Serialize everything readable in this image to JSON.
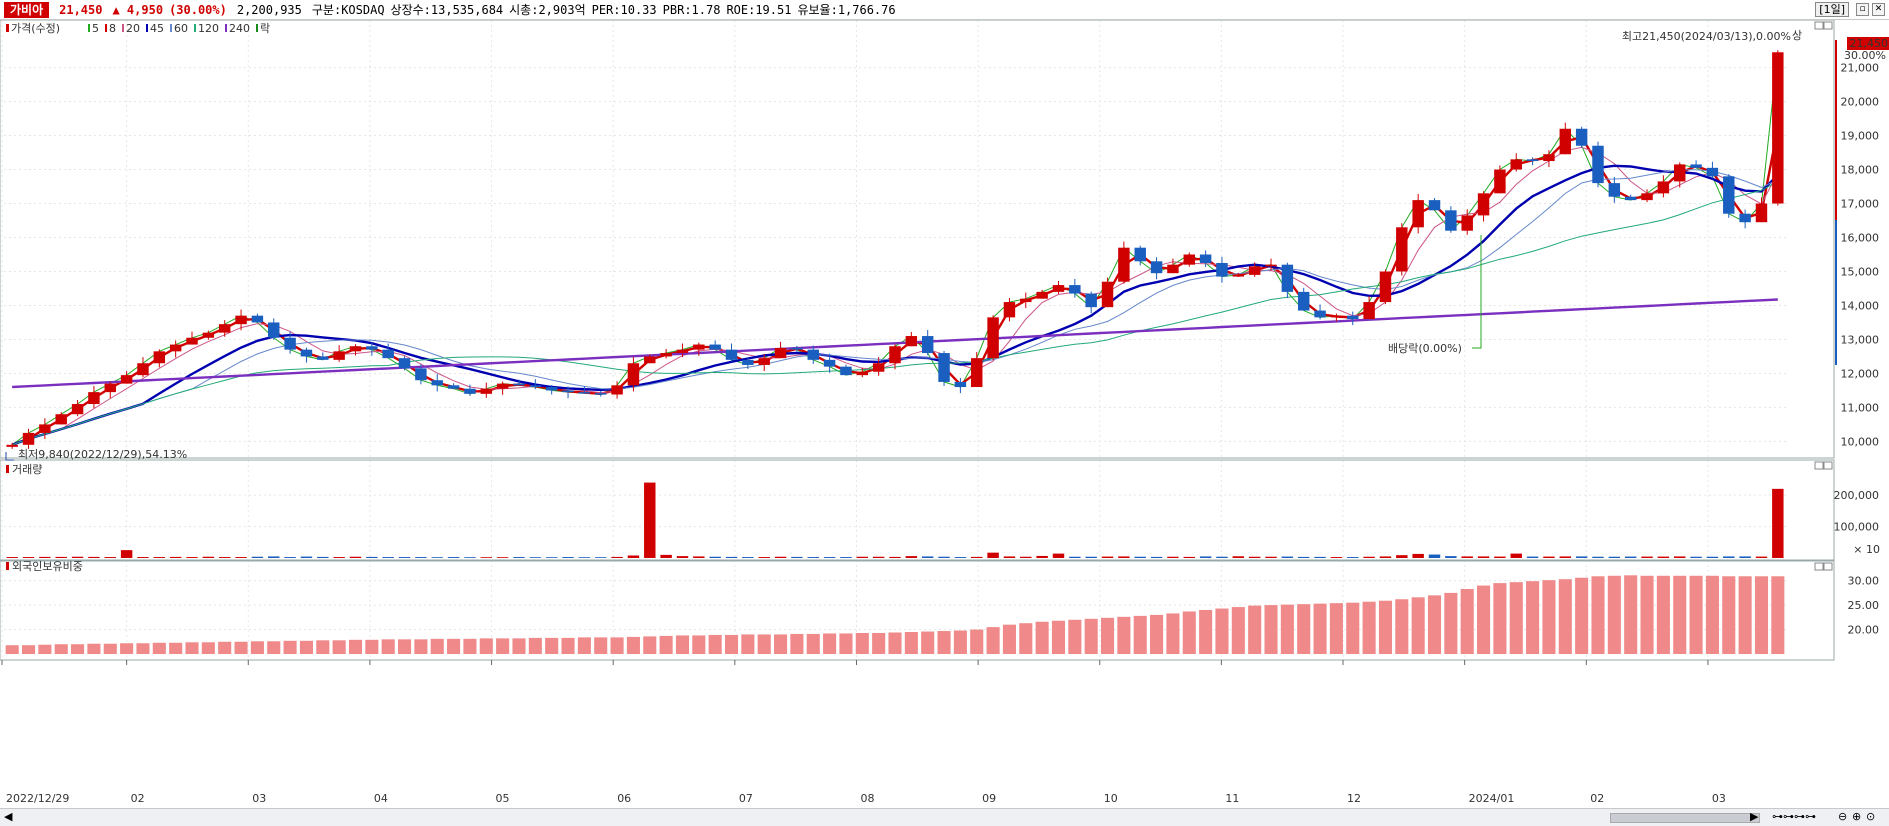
{
  "header": {
    "name": "가비아",
    "price": "21,450",
    "change": "▲ 4,950",
    "change_pct": "(30.00%)",
    "volume": "2,200,935",
    "market": "구분:KOSDAQ",
    "shares": "상장수:13,535,684",
    "mktcap": "시총:2,903억",
    "per": "PER:10.33",
    "pbr": "PBR:1.78",
    "roe": "ROE:19.51",
    "reserve": "유보율:1,766.76",
    "period": "[1일]"
  },
  "legend": {
    "price": "가격(수정)",
    "ma": [
      "5",
      "8",
      "20",
      "45",
      "60",
      "120",
      "240"
    ],
    "tail": "락",
    "ma_colors": [
      "#22aa22",
      "#d10000",
      "#cc5588",
      "#0000b0",
      "#6688cc",
      "#22aa77",
      "#7a2fbf"
    ]
  },
  "annotations": {
    "high": "최고21,450(2024/03/13),0.00%",
    "high_tag": "상",
    "low": "최저9,840(2022/12/29),54.13%",
    "dividend": "배당락(0.00%)",
    "price_tag": "21,450",
    "pct_tag": "30.00%"
  },
  "panels": {
    "volume_title": "거래량",
    "volume_unit": "× 10",
    "foreign_title": "외국인보유비중"
  },
  "chart_data": [
    {
      "type": "candlestick",
      "title": "가격(수정)",
      "x_labels": [
        "2022/12/29",
        "02",
        "03",
        "04",
        "05",
        "06",
        "07",
        "08",
        "09",
        "10",
        "11",
        "12",
        "2024/01",
        "02",
        "03"
      ],
      "y_ticks": [
        "10,000",
        "11,000",
        "12,000",
        "13,000",
        "14,000",
        "15,000",
        "16,000",
        "17,000",
        "18,000",
        "19,000",
        "20,000",
        "21,000"
      ],
      "ylim": [
        9600,
        22400
      ],
      "close": [
        9900,
        10250,
        10500,
        10800,
        11100,
        11450,
        11700,
        11950,
        12300,
        12650,
        12850,
        13050,
        13200,
        13450,
        13700,
        13500,
        13050,
        12700,
        12500,
        12400,
        12650,
        12800,
        12700,
        12450,
        12150,
        11800,
        11650,
        11550,
        11400,
        11550,
        11700,
        11650,
        11600,
        11500,
        11450,
        11420,
        11380,
        11650,
        12300,
        12500,
        12600,
        12700,
        12850,
        12700,
        12400,
        12250,
        12450,
        12750,
        12700,
        12400,
        12200,
        11950,
        12050,
        12300,
        12800,
        13100,
        12600,
        11750,
        11600,
        12450,
        13650,
        14100,
        14200,
        14400,
        14600,
        14350,
        13950,
        14700,
        15700,
        15300,
        14950,
        15200,
        15500,
        15250,
        14850,
        14900,
        15150,
        15200,
        14400,
        13850,
        13650,
        13700,
        13600,
        14100,
        15000,
        16300,
        17100,
        16800,
        16200,
        16650,
        17300,
        18000,
        18300,
        18250,
        18450,
        19200,
        18700,
        17600,
        17200,
        17100,
        17300,
        17650,
        18150,
        18050,
        17800,
        16700,
        16450,
        17000,
        21450
      ]
    },
    {
      "type": "bar",
      "title": "거래량",
      "y_ticks": [
        "200,000",
        "100,000"
      ],
      "ylim": [
        0,
        280000
      ],
      "values": [
        3000,
        3000,
        3500,
        3500,
        4000,
        3500,
        3000,
        25000,
        3000,
        3000,
        3500,
        3000,
        4000,
        3000,
        3000,
        4000,
        5000,
        3000,
        4500,
        3500,
        3000,
        4000,
        3500,
        3000,
        3000,
        3000,
        2500,
        3000,
        2500,
        2500,
        2500,
        3000,
        2500,
        2500,
        3000,
        2500,
        2500,
        3500,
        8000,
        240000,
        10000,
        6000,
        5000,
        4000,
        3500,
        3000,
        3000,
        4000,
        3500,
        3000,
        3000,
        3000,
        4000,
        4000,
        3500,
        6000,
        5000,
        4000,
        3000,
        3500,
        17000,
        5000,
        4000,
        6500,
        14000,
        4000,
        4000,
        4500,
        5000,
        4000,
        3500,
        4000,
        3500,
        5000,
        4000,
        5500,
        4000,
        4000,
        4500,
        3500,
        3500,
        3000,
        3000,
        4000,
        5000,
        9000,
        13000,
        11000,
        6000,
        5000,
        5000,
        4500,
        14000,
        4500,
        4500,
        5000,
        5000,
        4000,
        4000,
        4500,
        4500,
        4500,
        5000,
        4000,
        4000,
        5000,
        5000,
        4500,
        220000
      ]
    },
    {
      "type": "bar",
      "title": "외국인보유비중",
      "y_ticks": [
        "30.00",
        "25.00",
        "20.00"
      ],
      "ylim": [
        15,
        33
      ],
      "values": [
        16.8,
        16.8,
        16.9,
        17,
        17,
        17.1,
        17.1,
        17.2,
        17.2,
        17.3,
        17.3,
        17.4,
        17.4,
        17.5,
        17.5,
        17.6,
        17.6,
        17.7,
        17.7,
        17.8,
        17.8,
        17.9,
        17.9,
        18,
        18,
        18,
        18.1,
        18.1,
        18.1,
        18.2,
        18.2,
        18.2,
        18.3,
        18.3,
        18.3,
        18.4,
        18.4,
        18.4,
        18.5,
        18.6,
        18.7,
        18.8,
        18.8,
        18.9,
        18.9,
        19,
        19,
        19,
        19.1,
        19.1,
        19.2,
        19.2,
        19.3,
        19.3,
        19.4,
        19.5,
        19.6,
        19.7,
        19.8,
        20,
        20.5,
        21,
        21.3,
        21.6,
        21.8,
        22,
        22.2,
        22.4,
        22.6,
        22.8,
        23,
        23.3,
        23.7,
        24,
        24.3,
        24.6,
        24.9,
        25,
        25.1,
        25.2,
        25.3,
        25.4,
        25.5,
        25.7,
        25.9,
        26.2,
        26.6,
        27,
        27.5,
        28.3,
        29,
        29.5,
        29.7,
        29.9,
        30.1,
        30.3,
        30.6,
        30.9,
        31,
        31.1,
        31,
        31,
        31,
        31,
        31,
        30.9,
        30.9,
        30.9,
        30.9
      ]
    }
  ]
}
